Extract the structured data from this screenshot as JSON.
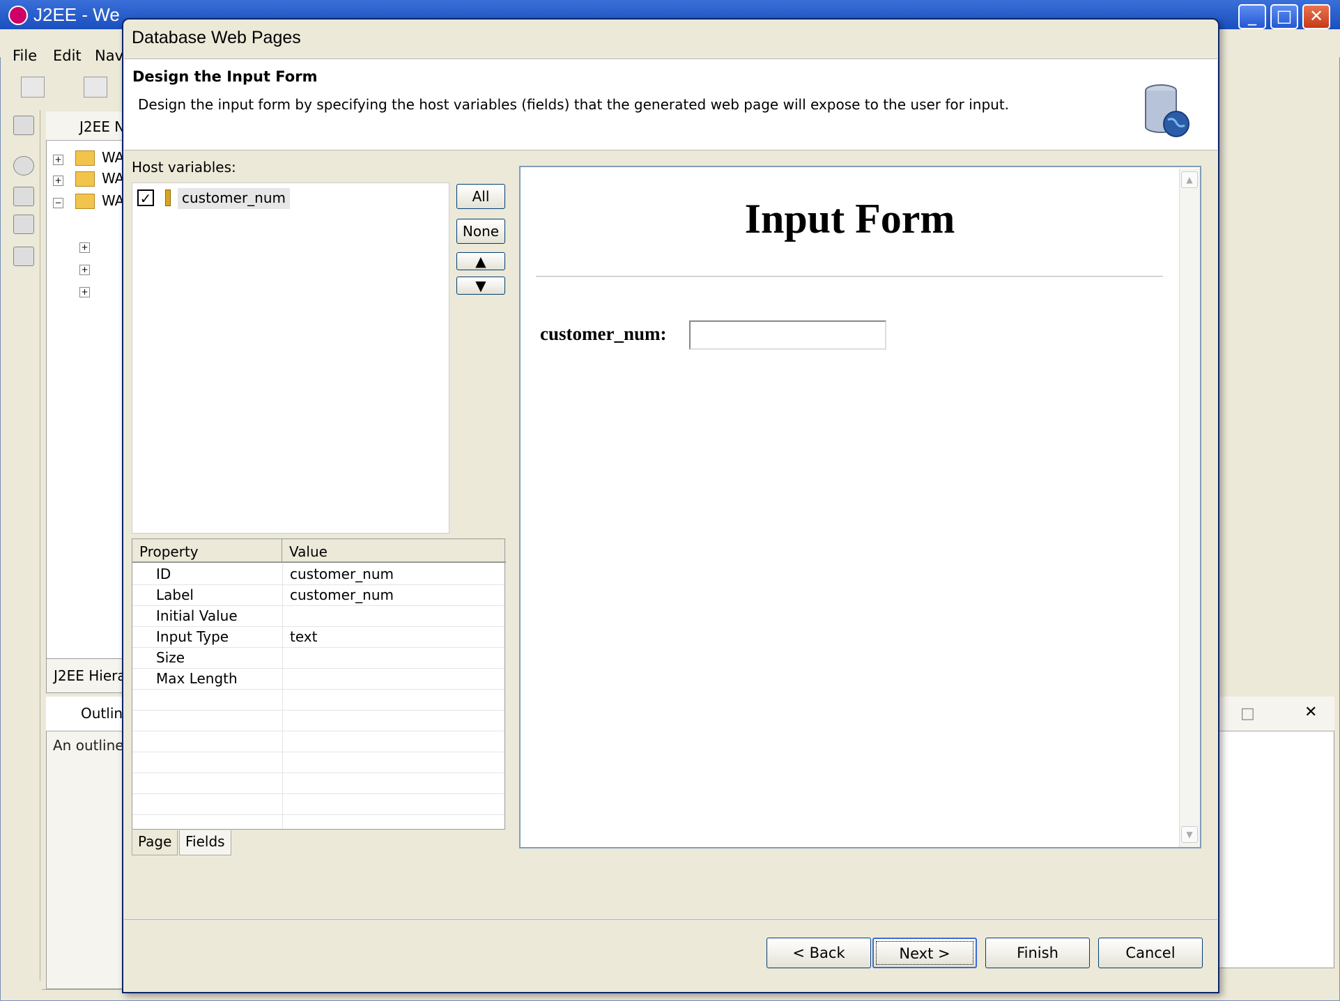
{
  "background_window": {
    "title": "J2EE - We",
    "menus": [
      "File",
      "Edit",
      "Nav"
    ],
    "tree_tab": "J2EE N",
    "tree_items": [
      "WA",
      "WA",
      "WA"
    ],
    "hierarchy_tab": "J2EE Hiera",
    "outline_tab": "Outlin",
    "outline_text": "An outline"
  },
  "dialog": {
    "title": "Database Web Pages",
    "header_title": "Design the Input Form",
    "header_description": "Design the input form by specifying the host variables (fields) that the generated web page will expose to the user for input.",
    "host_variables_label": "Host variables:",
    "host_variables": [
      {
        "name": "customer_num",
        "checked": true
      }
    ],
    "buttons": {
      "all": "All",
      "none": "None",
      "up": "▲",
      "down": "▼"
    },
    "property_table": {
      "headers": [
        "Property",
        "Value"
      ],
      "rows": [
        {
          "property": "ID",
          "value": "customer_num"
        },
        {
          "property": "Label",
          "value": "customer_num"
        },
        {
          "property": "Initial Value",
          "value": ""
        },
        {
          "property": "Input Type",
          "value": "text"
        },
        {
          "property": "Size",
          "value": ""
        },
        {
          "property": "Max Length",
          "value": ""
        }
      ]
    },
    "tabs": [
      "Page",
      "Fields"
    ],
    "preview": {
      "title": "Input Form",
      "field_label": "customer_num:"
    },
    "nav": {
      "back": "< Back",
      "next": "Next >",
      "finish": "Finish",
      "cancel": "Cancel"
    }
  }
}
